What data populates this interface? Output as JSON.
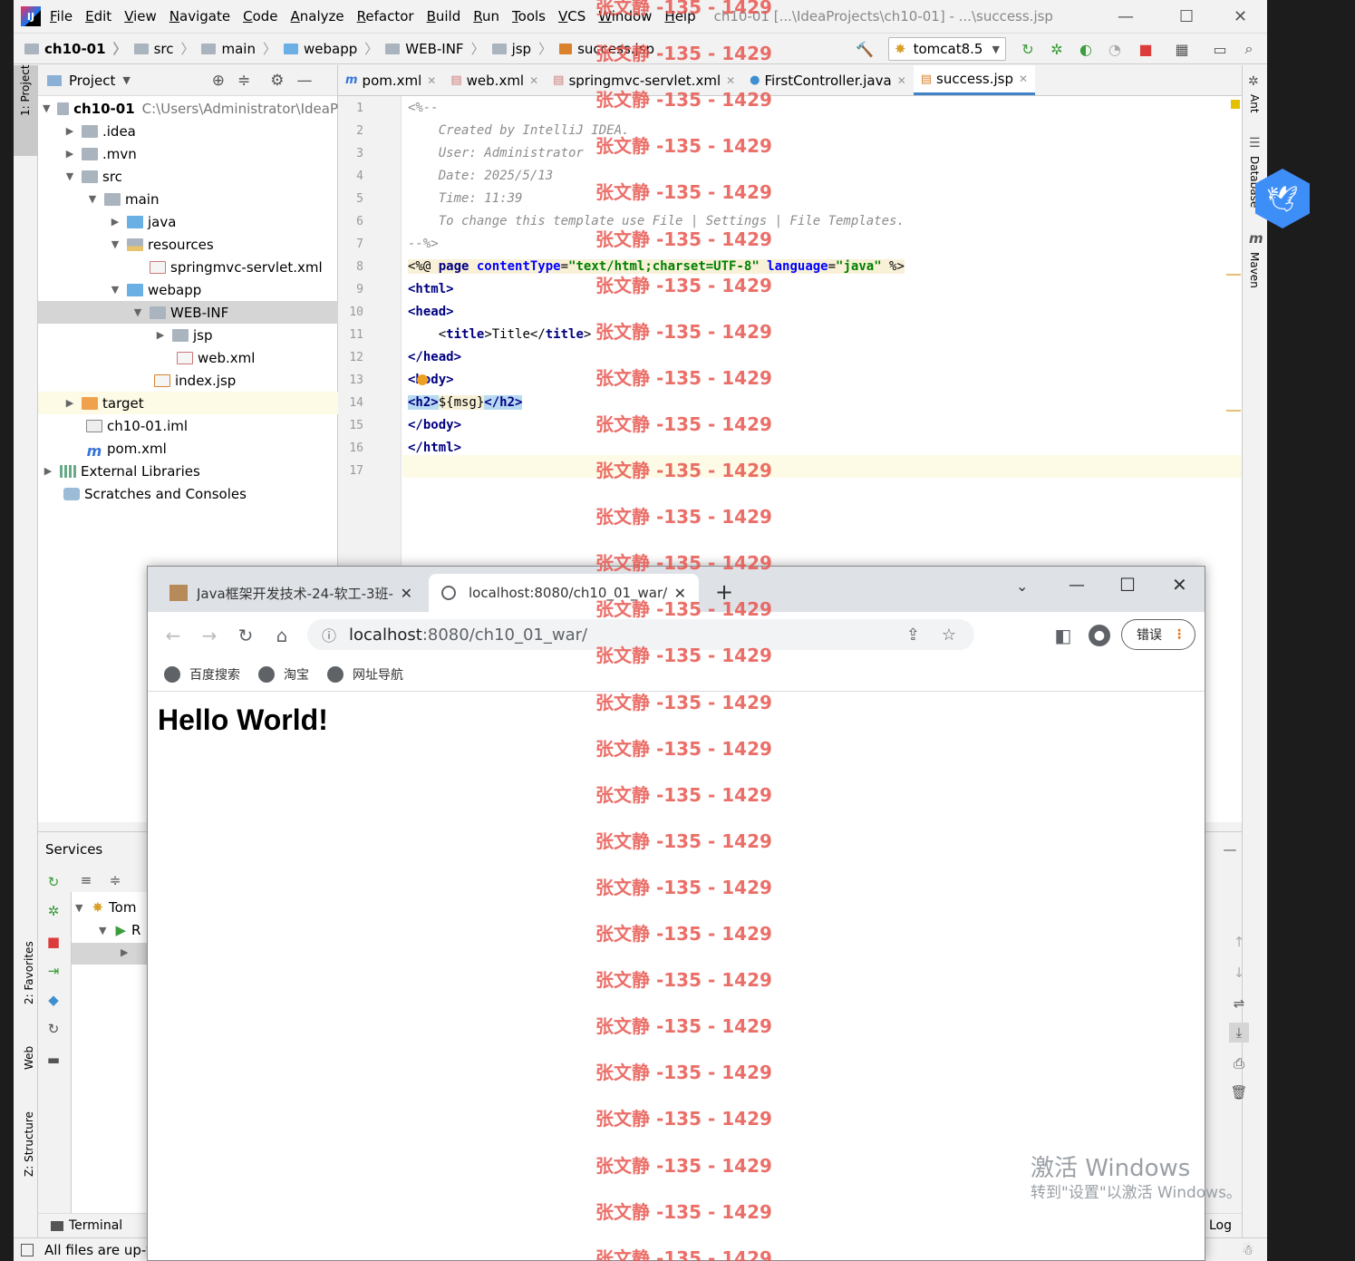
{
  "ide": {
    "menu": [
      "File",
      "Edit",
      "View",
      "Navigate",
      "Code",
      "Analyze",
      "Refactor",
      "Build",
      "Run",
      "Tools",
      "VCS",
      "Window",
      "Help"
    ],
    "window_title": "ch10-01 [...\\IdeaProjects\\ch10-01] - ...\\success.jsp",
    "breadcrumbs": [
      "ch10-01",
      "src",
      "main",
      "webapp",
      "WEB-INF",
      "jsp",
      "success.jsp"
    ],
    "run_config": "tomcat8.5",
    "project_panel_title": "Project",
    "project_path": "C:\\Users\\Administrator\\IdeaP",
    "tree": [
      "ch10-01",
      ".idea",
      ".mvn",
      "src",
      "main",
      "java",
      "resources",
      "springmvc-servlet.xml",
      "webapp",
      "WEB-INF",
      "jsp",
      "web.xml",
      "index.jsp",
      "target",
      "ch10-01.iml",
      "pom.xml",
      "External Libraries",
      "Scratches and Consoles"
    ],
    "tabs": [
      "pom.xml",
      "web.xml",
      "springmvc-servlet.xml",
      "FirstController.java",
      "success.jsp"
    ],
    "code": {
      "l1": "<%--",
      "l2": "    Created by IntelliJ IDEA.",
      "l3": "    User: Administrator",
      "l4": "    Date: 2025/5/13",
      "l5": "    Time: 11:39",
      "l6": "    To change this template use File | Settings | File Templates.",
      "l7": "--%>",
      "l8_a": "<%@ ",
      "l8_b": "page ",
      "l8_c": "contentType",
      "l8_d": "=",
      "l8_e": "\"text/html;charset=UTF-8\"",
      "l8_f": " language",
      "l8_g": "=",
      "l8_h": "\"java\"",
      "l8_i": " %>",
      "l9": "<html>",
      "l10": "<head>",
      "l11_a": "    <",
      "l11_b": "title",
      "l11_c": ">Title</",
      "l11_d": "title",
      "l11_e": ">",
      "l12": "</head>",
      "l13": "<body>",
      "l14_a": "<h2>",
      "l14_b": "${msg}",
      "l14_c": "</h2>",
      "l15": "</body>",
      "l16": "</html>"
    },
    "line_numbers": [
      "1",
      "2",
      "3",
      "4",
      "5",
      "6",
      "7",
      "8",
      "9",
      "10",
      "11",
      "12",
      "13",
      "14",
      "15",
      "16",
      "17"
    ],
    "services_title": "Services",
    "services_tree": [
      "Tom",
      "R"
    ],
    "bottom_tab": "Terminal",
    "right_log": "Log",
    "status": "All files are up-t",
    "left_strip": [
      "1: Project",
      "2: Favorites",
      "Web",
      "Z: Structure"
    ],
    "right_strip": [
      "Ant",
      "Database",
      "Maven"
    ]
  },
  "browser": {
    "tab1": "Java框架开发技术-24-软工-3班-",
    "tab2": "localhost:8080/ch10_01_war/",
    "url_host": "localhost",
    "url_rest": ":8080/ch10_01_war/",
    "bookmarks": [
      "百度搜索",
      "淘宝",
      "网址导航"
    ],
    "error_label": "错误",
    "heading": "Hello World!"
  },
  "watermark": "张文静 -135 - 1429",
  "activate_title": "激活 Windows",
  "activate_sub": "转到\"设置\"以激活 Windows。"
}
